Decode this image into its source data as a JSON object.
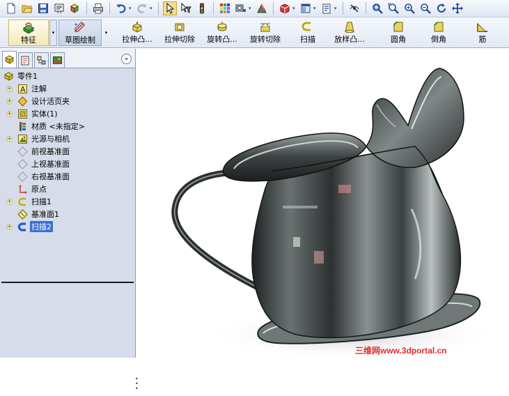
{
  "toolbar": {
    "buttons": [
      {
        "name": "new-document-icon"
      },
      {
        "name": "open-folder-icon"
      },
      {
        "name": "save-icon"
      },
      {
        "name": "make-drawing-icon"
      },
      {
        "name": "make-assembly-icon"
      },
      {
        "name": "print-icon"
      },
      {
        "name": "undo-icon"
      },
      {
        "name": "redo-icon"
      },
      {
        "name": "select-pointer-icon"
      },
      {
        "name": "select-filter-icon"
      },
      {
        "name": "rebuild-traffic-light-icon"
      },
      {
        "name": "options-grid-icon"
      },
      {
        "name": "photoworks-icon"
      },
      {
        "name": "realview-icon"
      },
      {
        "name": "appearance-icon"
      },
      {
        "name": "display-style-icon"
      },
      {
        "name": "tools-options-icon"
      },
      {
        "name": "hide-show-icon"
      },
      {
        "name": "zoom-to-fit-icon"
      },
      {
        "name": "zoom-to-area-icon"
      },
      {
        "name": "zoom-in-out-icon"
      },
      {
        "name": "zoom-to-selection-icon"
      },
      {
        "name": "rotate-view-icon"
      },
      {
        "name": "pan-icon"
      }
    ]
  },
  "command_manager": {
    "tabs": [
      {
        "label": "特征",
        "active": true
      },
      {
        "label": "草图绘制",
        "active": false
      }
    ],
    "commands": [
      {
        "label": "拉伸凸..."
      },
      {
        "label": "拉伸切除"
      },
      {
        "label": "旋转凸..."
      },
      {
        "label": "旋转切除"
      },
      {
        "label": "扫描"
      },
      {
        "label": "放样凸..."
      },
      {
        "label": "圆角"
      },
      {
        "label": "倒角"
      },
      {
        "label": "筋"
      }
    ]
  },
  "feature_tree": {
    "expand_glyph": "+",
    "collapse_panel_glyph": "»",
    "items": [
      {
        "label": "零件1",
        "icon": "part-icon",
        "level": 0,
        "expandable": false
      },
      {
        "label": "注解",
        "icon": "annotations-icon",
        "level": 1,
        "expandable": true
      },
      {
        "label": "设计活页夹",
        "icon": "design-binder-icon",
        "level": 1,
        "expandable": true
      },
      {
        "label": "实体(1)",
        "icon": "solid-bodies-icon",
        "level": 1,
        "expandable": true
      },
      {
        "label": "材质 <未指定>",
        "icon": "material-icon",
        "level": 1,
        "expandable": false
      },
      {
        "label": "光源与相机",
        "icon": "lights-cameras-icon",
        "level": 1,
        "expandable": true
      },
      {
        "label": "前视基准面",
        "icon": "plane-icon",
        "level": 1,
        "expandable": false
      },
      {
        "label": "上视基准面",
        "icon": "plane-icon",
        "level": 1,
        "expandable": false
      },
      {
        "label": "右视基准面",
        "icon": "plane-icon",
        "level": 1,
        "expandable": false
      },
      {
        "label": "原点",
        "icon": "origin-icon",
        "level": 1,
        "expandable": false
      },
      {
        "label": "扫描1",
        "icon": "sweep-feature-icon",
        "level": 1,
        "expandable": true
      },
      {
        "label": "基准面1",
        "icon": "reference-plane-icon",
        "level": 1,
        "expandable": false
      },
      {
        "label": "扫描2",
        "icon": "sweep-feature-icon",
        "level": 1,
        "expandable": true,
        "selected": true
      }
    ]
  },
  "graphics": {
    "model": "pitcher-model",
    "watermark": "三维网www.3dportal.cn",
    "colors": {
      "watermark": "#e52b2b",
      "body_metal": "#4a4f4f",
      "selection": "#3a6fd8"
    }
  }
}
